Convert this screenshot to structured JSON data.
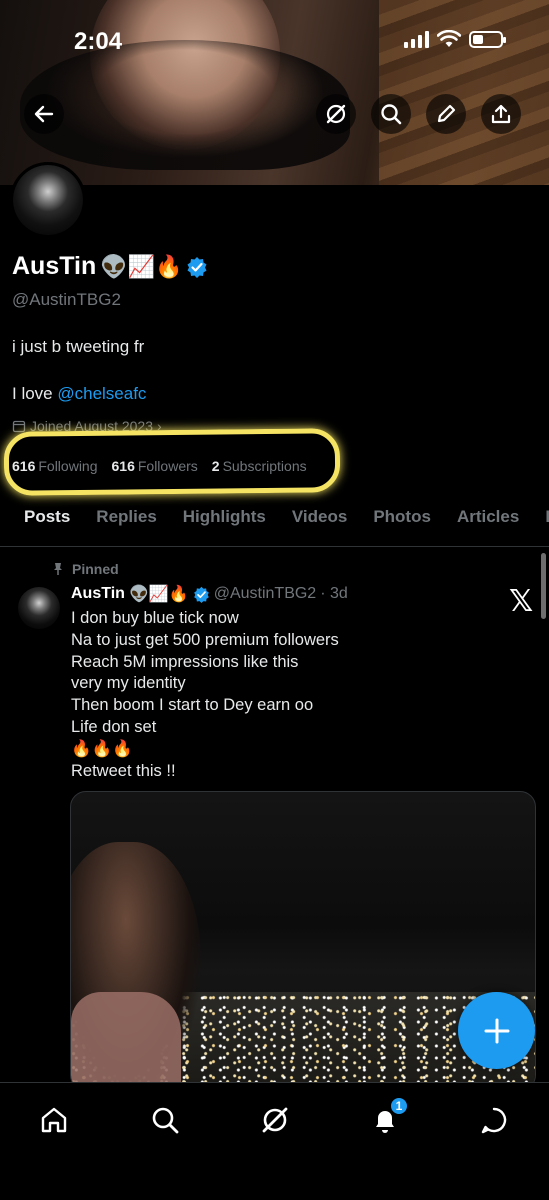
{
  "status_bar": {
    "time": "2:04",
    "battery_level": 0.3
  },
  "header": {
    "icons": [
      "back-arrow-icon",
      "grok-icon",
      "search-icon",
      "edit-icon",
      "share-icon"
    ]
  },
  "profile": {
    "name": "AusTin",
    "name_emojis": "👽📈🔥",
    "verified": true,
    "handle": "@AustinTBG2",
    "bio_line1": "i just b tweeting fr",
    "bio_line2_prefix": "I love ",
    "bio_line2_link": "@chelseafc",
    "joined": "Joined August 2023",
    "following_count": "616",
    "following_label": "Following",
    "followers_count": "616",
    "followers_label": "Followers",
    "subscriptions_count": "2",
    "subscriptions_label": "Subscriptions"
  },
  "tabs": [
    "Posts",
    "Replies",
    "Highlights",
    "Videos",
    "Photos",
    "Articles",
    "Li"
  ],
  "active_tab": "Posts",
  "post": {
    "pinned_label": "Pinned",
    "author_name": "AusTin",
    "author_emojis": "👽📈🔥",
    "author_handle": "@AustinTBG2",
    "time": "· 3d",
    "text": "I don buy blue tick now\nNa to just get 500 premium followers\nReach 5M impressions like this\nvery my identity\nThen boom I start to Dey earn oo\nLife don set\n🔥🔥🔥\nRetweet this !!"
  },
  "bottom_nav": {
    "items": [
      "home-icon",
      "search-icon",
      "grok-icon",
      "notifications-icon",
      "messages-icon"
    ],
    "notifications_badge": "1"
  },
  "colors": {
    "accent": "#1d9bf0",
    "highlight": "#f5e463",
    "background": "#000000",
    "muted": "#71767b"
  }
}
